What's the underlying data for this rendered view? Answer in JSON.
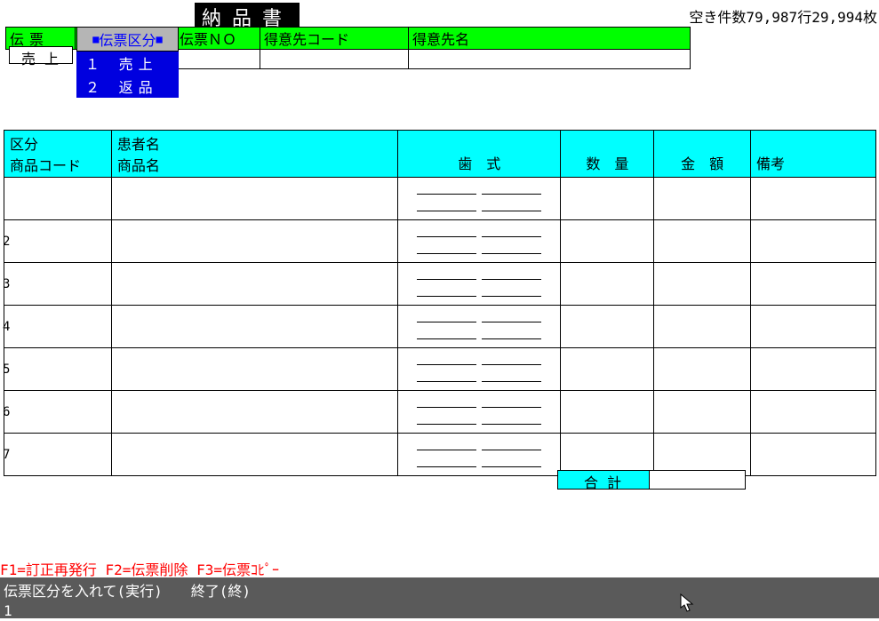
{
  "title": "納品書",
  "count_label": "空き件数79,987行29,994枚",
  "header": {
    "denpyo_label": "伝票",
    "kubun_label": "伝票区分",
    "no_label": "伝票ＮＯ",
    "code_label": "得意先コード",
    "name_label": "得意先名",
    "sale_value": "売上",
    "no_value": "",
    "code_value": "",
    "name_value": ""
  },
  "dropdown": {
    "title": "伝票区分",
    "items": [
      "１ 売上",
      "２ 返品"
    ]
  },
  "lines_header": {
    "kubun1": "区分",
    "kubun2": "商品コード",
    "name1": "患者名",
    "name2": "商品名",
    "shiki": "歯　式",
    "qty": "数　量",
    "amt": "金　額",
    "bikou": "備考"
  },
  "row_nums": [
    "",
    "2",
    "3",
    "4",
    "5",
    "6",
    "7"
  ],
  "total_label": "合計",
  "total_value": "",
  "fkeys": "F1=訂正再発行 F2=伝票削除 F3=伝票ｺﾋﾟｰ",
  "status": {
    "line1": "伝票区分を入れて(実行)　　終了(終)",
    "line2": "1"
  }
}
